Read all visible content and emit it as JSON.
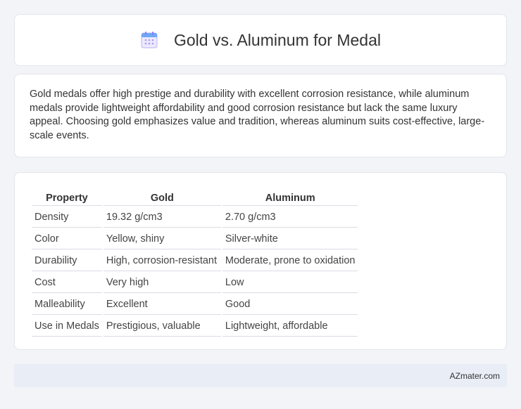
{
  "header": {
    "title": "Gold vs. Aluminum for Medal",
    "icon": "calendar-icon",
    "icon_color": "#7b6cf6"
  },
  "summary": {
    "text": "Gold medals offer high prestige and durability with excellent corrosion resistance, while aluminum medals provide lightweight affordability and good corrosion resistance but lack the same luxury appeal. Choosing gold emphasizes value and tradition, whereas aluminum suits cost-effective, large-scale events."
  },
  "table": {
    "headers": [
      "Property",
      "Gold",
      "Aluminum"
    ],
    "rows": [
      [
        "Density",
        "19.32 g/cm3",
        "2.70 g/cm3"
      ],
      [
        "Color",
        "Yellow, shiny",
        "Silver-white"
      ],
      [
        "Durability",
        "High, corrosion-resistant",
        "Moderate, prone to oxidation"
      ],
      [
        "Cost",
        "Very high",
        "Low"
      ],
      [
        "Malleability",
        "Excellent",
        "Good"
      ],
      [
        "Use in Medals",
        "Prestigious, valuable",
        "Lightweight, affordable"
      ]
    ]
  },
  "footer": {
    "brand": "AZmater.com"
  }
}
